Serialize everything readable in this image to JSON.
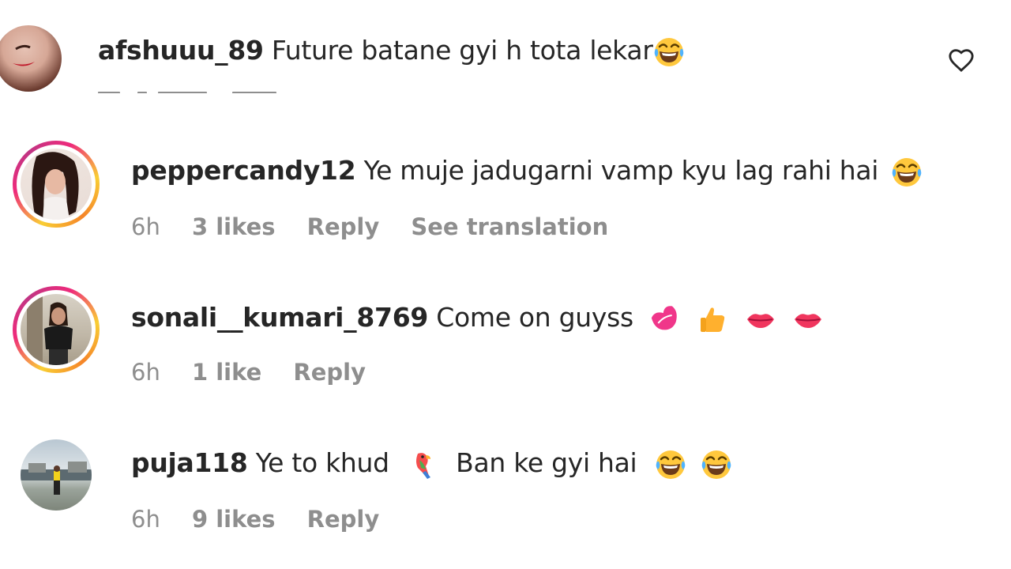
{
  "comments": [
    {
      "username": "afshuuu_89",
      "text": "Future batane gyi h tota lekar",
      "emoji": [
        "face-with-tears-of-joy"
      ]
    },
    {
      "username": "peppercandy12",
      "text": "Ye muje jadugarni vamp kyu lag rahi hai",
      "emoji": [
        "face-with-tears-of-joy"
      ],
      "time": "6h",
      "likes": "3 likes",
      "reply": "Reply",
      "translate": "See translation"
    },
    {
      "username": "sonali__kumari_8769",
      "text": "Come on guyss",
      "emoji": [
        "kiss-mark",
        "thumbs-up",
        "lips",
        "lips"
      ],
      "time": "6h",
      "likes": "1 like",
      "reply": "Reply"
    },
    {
      "username": "puja118",
      "text": "Ye to khud",
      "emoji_mid": [
        "parrot"
      ],
      "text2": "Ban ke gyi hai",
      "emoji": [
        "face-with-tears-of-joy",
        "face-with-tears-of-joy"
      ],
      "time": "6h",
      "likes": "9 likes",
      "reply": "Reply"
    }
  ],
  "colors": {
    "text": "#262626",
    "meta": "#8e8e8e",
    "story_ring_start": "#f9ce34",
    "story_ring_mid": "#ee2a7b",
    "story_ring_end": "#c13584"
  }
}
